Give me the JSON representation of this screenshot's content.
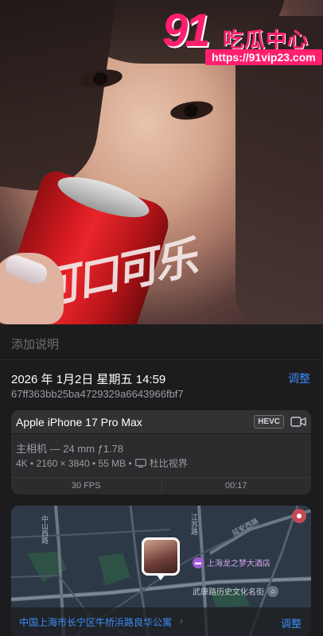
{
  "watermark": {
    "number": "91",
    "name": "吃瓜中心",
    "url": "https://91vip23.com"
  },
  "photo": {
    "can_logo": "可口可乐"
  },
  "info": {
    "caption_placeholder": "添加说明",
    "datetime": "2026 年 1月2日 星期五 14:59",
    "adjust_label": "调整",
    "hash": "67ff363bb25ba4729329a6643966fbf7"
  },
  "camera": {
    "device": "Apple iPhone 17 Pro Max",
    "codec_badge": "HEVC",
    "lens": "主相机 — 24 mm ƒ1.78",
    "specs": "4K • 2160 × 3840 • 55 MB •",
    "hdr": "杜比视界",
    "fps": "30 FPS",
    "duration": "00:17"
  },
  "map": {
    "road_left": "中山西路",
    "road_mid": "江苏路",
    "road_diag": "延安西路",
    "poi_hotel": "上海龙之梦大酒店",
    "poi_street": "武康路历史文化名街",
    "address": "中国上海市长宁区牛桥浜路良华公寓",
    "adjust_label": "调整"
  },
  "colors": {
    "accent": "#3b8cf7",
    "watermark": "#ff1f6e",
    "panel_bg": "#1c1c1e",
    "card_bg": "#2c2c2e"
  }
}
